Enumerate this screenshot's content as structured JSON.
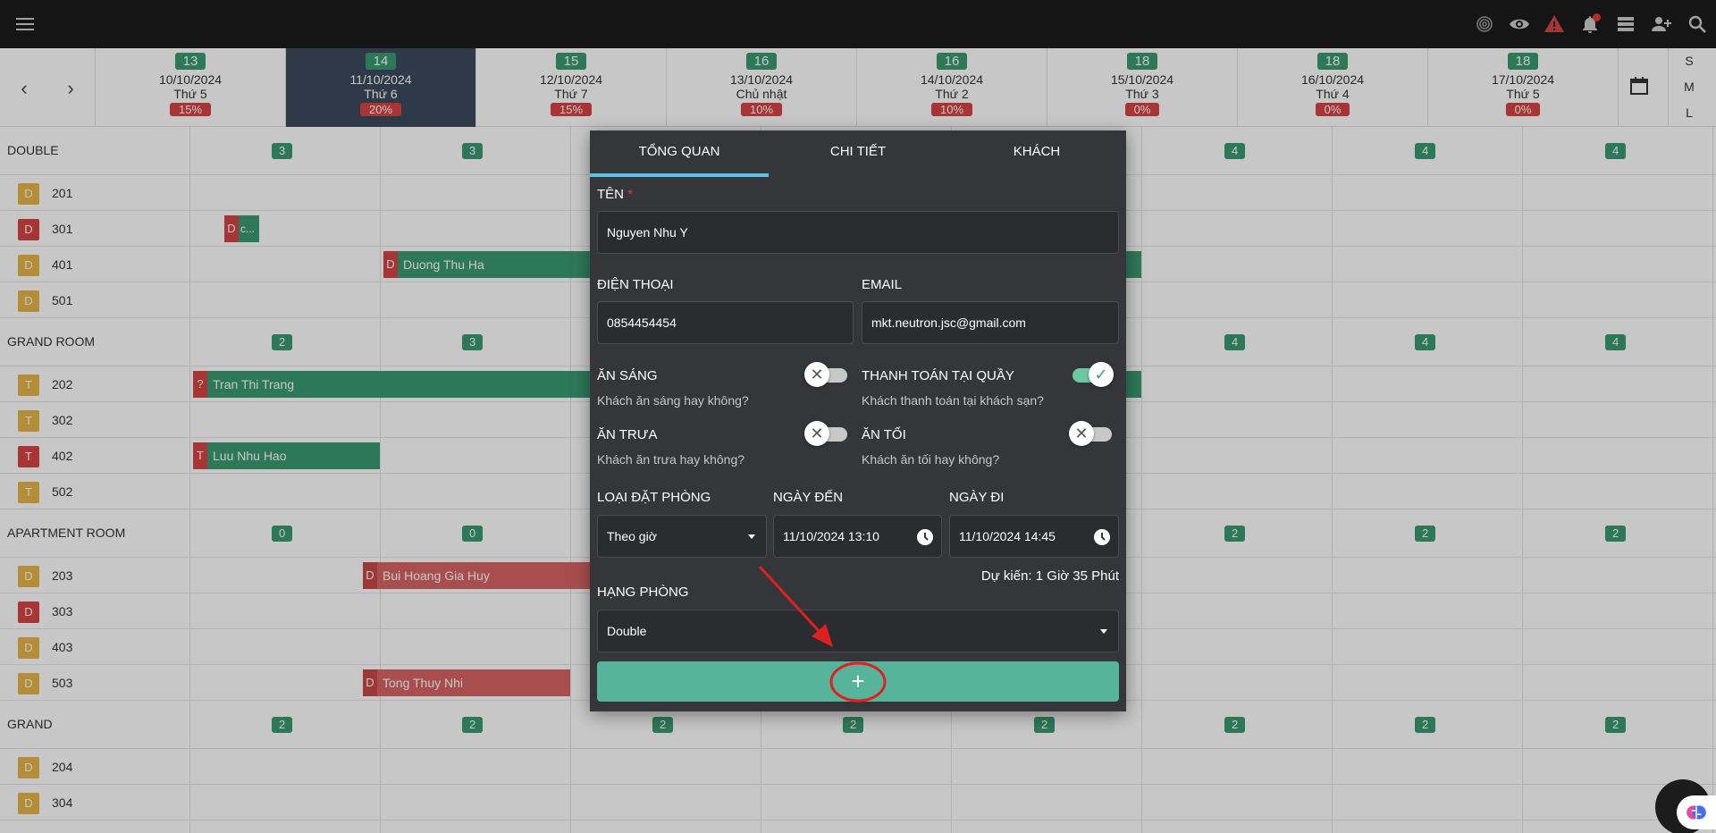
{
  "calendar": {
    "days": [
      {
        "num": "13",
        "date": "10/10/2024",
        "weekday": "Thứ 5",
        "pct": "15%"
      },
      {
        "num": "14",
        "date": "11/10/2024",
        "weekday": "Thứ 6",
        "pct": "20%"
      },
      {
        "num": "15",
        "date": "12/10/2024",
        "weekday": "Thứ 7",
        "pct": "15%"
      },
      {
        "num": "16",
        "date": "13/10/2024",
        "weekday": "Chủ nhật",
        "pct": "10%"
      },
      {
        "num": "16",
        "date": "14/10/2024",
        "weekday": "Thứ 2",
        "pct": "10%"
      },
      {
        "num": "18",
        "date": "15/10/2024",
        "weekday": "Thứ 3",
        "pct": "0%"
      },
      {
        "num": "18",
        "date": "16/10/2024",
        "weekday": "Thứ 4",
        "pct": "0%"
      },
      {
        "num": "18",
        "date": "17/10/2024",
        "weekday": "Thứ 5",
        "pct": "0%"
      }
    ],
    "view_sizes": [
      "S",
      "M",
      "L"
    ],
    "prev_label": "‹",
    "next_label": "›"
  },
  "groups": {
    "double": {
      "label": "DOUBLE",
      "counts": [
        "3",
        "3",
        "4",
        "4",
        "4"
      ]
    },
    "grand_room": {
      "label": "GRAND ROOM",
      "counts": [
        "2",
        "3",
        "4",
        "4",
        "4"
      ]
    },
    "apartment_room": {
      "label": "APARTMENT ROOM",
      "counts": [
        "0",
        "0",
        "2",
        "2",
        "2"
      ]
    },
    "grand": {
      "label": "GRAND",
      "counts": [
        "2",
        "2",
        "2",
        "2",
        "2",
        "2",
        "2",
        "2"
      ]
    }
  },
  "rooms": {
    "r201": {
      "tag": "D",
      "num": "201"
    },
    "r301": {
      "tag": "D",
      "num": "301"
    },
    "r401": {
      "tag": "D",
      "num": "401"
    },
    "r501": {
      "tag": "D",
      "num": "501"
    },
    "r202": {
      "tag": "T",
      "num": "202"
    },
    "r302": {
      "tag": "T",
      "num": "302"
    },
    "r402": {
      "tag": "T",
      "num": "402"
    },
    "r502": {
      "tag": "T",
      "num": "502"
    },
    "r203": {
      "tag": "D",
      "num": "203"
    },
    "r303": {
      "tag": "D",
      "num": "303"
    },
    "r403": {
      "tag": "D",
      "num": "403"
    },
    "r503": {
      "tag": "D",
      "num": "503"
    },
    "r204": {
      "tag": "D",
      "num": "204"
    },
    "r304": {
      "tag": "D",
      "num": "304"
    }
  },
  "bookings": {
    "b301": {
      "tag": "D",
      "name": "c..."
    },
    "b401": {
      "tag": "D",
      "name": "Duong Thu Ha"
    },
    "b202": {
      "tag": "?",
      "name": "Tran Thi Trang"
    },
    "b402": {
      "tag": "T",
      "name": "Luu Nhu Hao"
    },
    "b203": {
      "tag": "D",
      "name": "Bui Hoang Gia Huy"
    },
    "b503": {
      "tag": "D",
      "name": "Tong Thuy Nhi"
    }
  },
  "modal": {
    "tabs": [
      "TỔNG QUAN",
      "CHI TIẾT",
      "KHÁCH"
    ],
    "name_label": "TÊN",
    "required_mark": "*",
    "name_value": "Nguyen Nhu Y",
    "phone_label": "ĐIỆN THOẠI",
    "phone_value": "0854454454",
    "email_label": "EMAIL",
    "email_value": "mkt.neutron.jsc@gmail.com",
    "breakfast_label": "ĂN SÁNG",
    "breakfast_help": "Khách ăn sáng hay không?",
    "breakfast_on": false,
    "pay_counter_label": "THANH TOÁN TẠI QUẦY",
    "pay_counter_help": "Khách thanh toán tại khách sạn?",
    "pay_counter_on": true,
    "lunch_label": "ĂN TRƯA",
    "lunch_help": "Khách ăn trưa hay không?",
    "lunch_on": false,
    "dinner_label": "ĂN TỐI",
    "dinner_help": "Khách ăn tối hay không?",
    "dinner_on": false,
    "booking_type_label": "LOẠI ĐẶT PHÒNG",
    "booking_type_value": "Theo giờ",
    "arrival_label": "NGÀY ĐẾN",
    "arrival_value": "11/10/2024 13:10",
    "departure_label": "NGÀY ĐI",
    "departure_value": "11/10/2024 14:45",
    "estimate_text": "Dự kiến: 1 Giờ 35 Phút",
    "room_class_label": "HẠNG PHÒNG",
    "room_class_value": "Double",
    "add_label": "+"
  },
  "colors": {
    "topbar": "#1c1c1c",
    "accent_green": "#3c9a74",
    "alert_red": "#d64545",
    "modal_bg": "#34363a",
    "add_button": "#55b49a",
    "tab_underline": "#5ec2e8"
  }
}
